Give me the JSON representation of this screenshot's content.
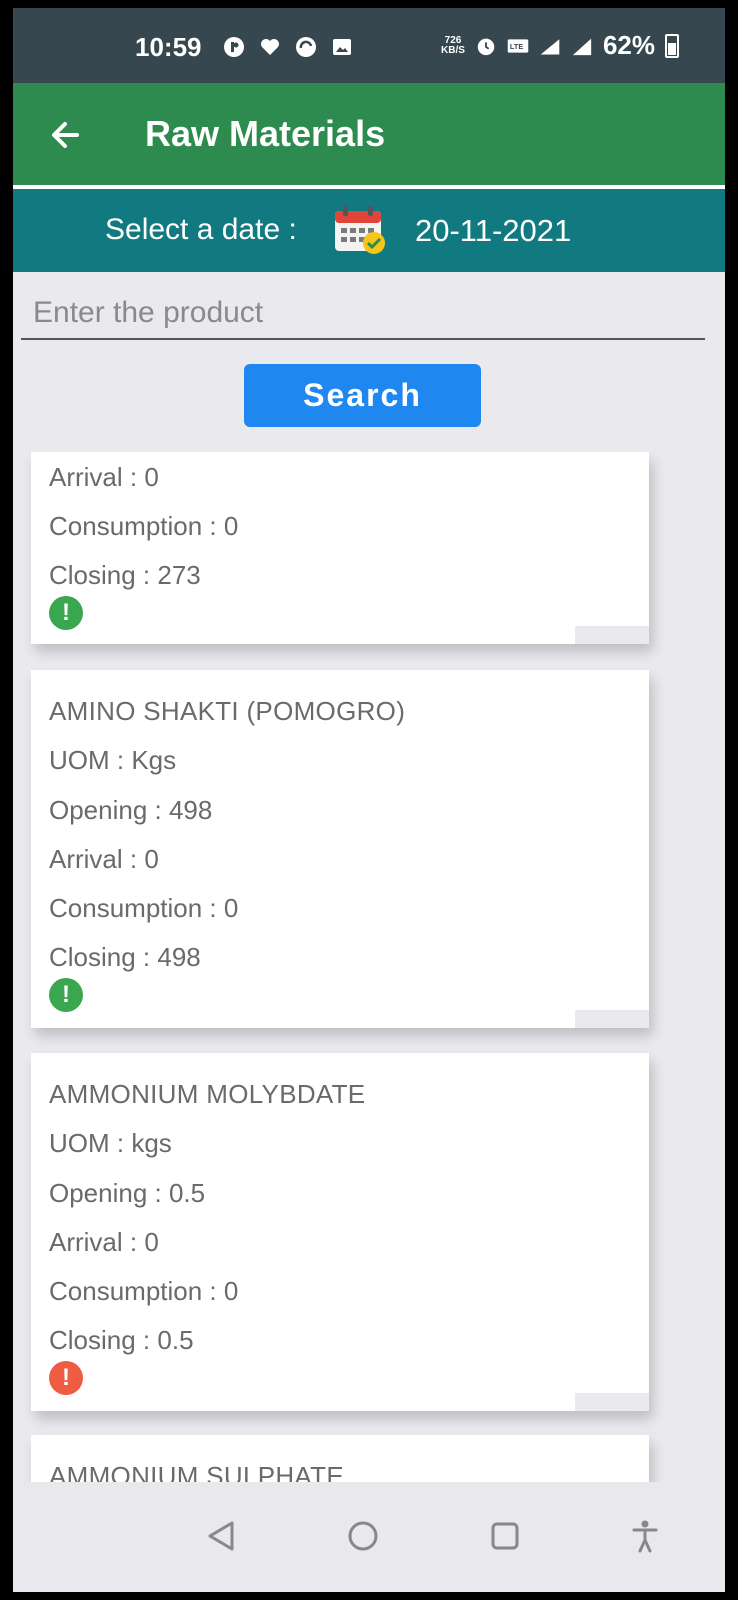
{
  "status_bar": {
    "time": "10:59",
    "net_speed_value": "726",
    "net_speed_unit": "KB/S",
    "battery_percent": "62%"
  },
  "app_bar": {
    "title": "Raw Materials"
  },
  "date_bar": {
    "label": "Select a date :",
    "date": "20-11-2021"
  },
  "search": {
    "placeholder": "Enter the product",
    "button_label": "Search"
  },
  "materials": [
    {
      "arrival": "Arrival : 0",
      "consumption": "Consumption : 0",
      "closing": "Closing : 273",
      "status": "ok"
    },
    {
      "name": "AMINO SHAKTI (POMOGRO)",
      "uom": "UOM : Kgs",
      "opening": "Opening : 498",
      "arrival": "Arrival : 0",
      "consumption": "Consumption : 0",
      "closing": "Closing : 498",
      "status": "ok"
    },
    {
      "name": "AMMONIUM MOLYBDATE",
      "uom": "UOM : kgs",
      "opening": "Opening : 0.5",
      "arrival": "Arrival : 0",
      "consumption": "Consumption : 0",
      "closing": "Closing : 0.5",
      "status": "low"
    },
    {
      "name": "AMMONIUM SULPHATE"
    }
  ],
  "colors": {
    "status_bar": "#37474f",
    "app_bar": "#2e8b4f",
    "date_bar": "#117a80",
    "search_button": "#1e88f0",
    "status_ok": "#3aa64f",
    "status_low": "#ef5b43"
  },
  "icons": {
    "back": "arrow-left-icon",
    "calendar": "calendar-check-icon",
    "status": "exclamation-circle-icon",
    "nav": [
      "back-triangle-icon",
      "home-circle-icon",
      "recents-square-icon",
      "accessibility-icon"
    ]
  }
}
